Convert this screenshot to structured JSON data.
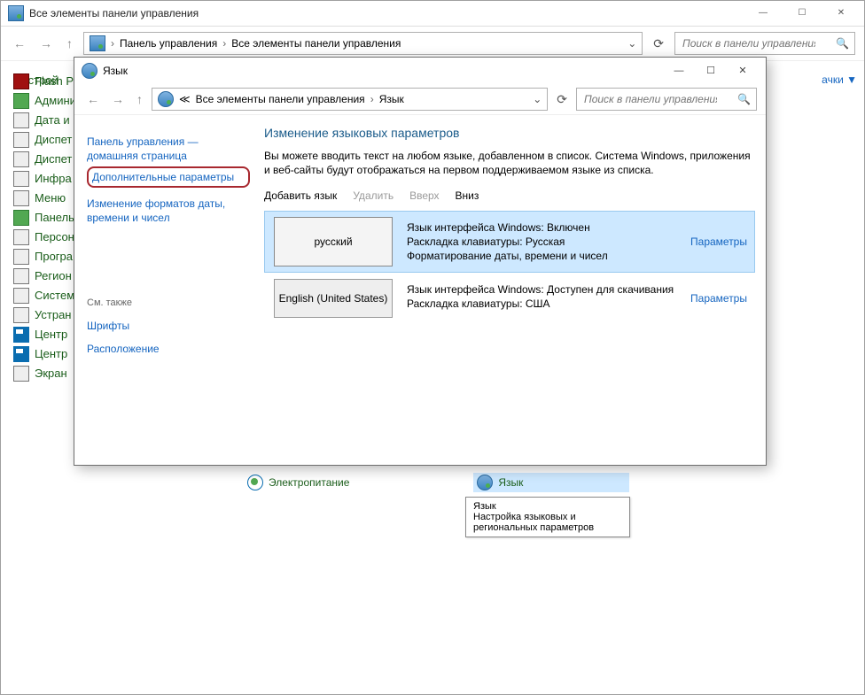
{
  "outer": {
    "title": "Все элементы панели управления",
    "crumb1": "Панель управления",
    "crumb2": "Все элементы панели управления",
    "search_ph": "Поиск в панели управления",
    "heading": "Настрой",
    "partial_link": "ачки ▼",
    "items": [
      "Flash Pl",
      "Админи",
      "Дата и",
      "Диспет",
      "Диспет",
      "Инфра",
      "Меню",
      "Панель",
      "Персон",
      "Програ",
      "Регион",
      "Систем",
      "Устран",
      "Центр",
      "Центр",
      "Экран"
    ],
    "extra_tile1": "Электропитание",
    "extra_tile2": "Язык",
    "tooltip_title": "Язык",
    "tooltip_body": "Настройка языковых и региональных параметров"
  },
  "modal": {
    "title": "Язык",
    "crumb_pre": "≪",
    "crumb1": "Все элементы панели управления",
    "crumb2": "Язык",
    "search_ph": "Поиск в панели управления",
    "side_home1": "Панель управления —",
    "side_home2": "домашняя страница",
    "side_adv": "Дополнительные параметры",
    "side_fmt": "Изменение форматов даты, времени и чисел",
    "side_see": "См. также",
    "side_fonts": "Шрифты",
    "side_loc": "Расположение",
    "heading": "Изменение языковых параметров",
    "para": "Вы можете вводить текст на любом языке, добавленном в список. Система Windows, приложения и веб-сайты будут отображаться на первом поддерживаемом языке из списка.",
    "cmds": {
      "add": "Добавить язык",
      "del": "Удалить",
      "up": "Вверх",
      "down": "Вниз"
    },
    "langs": [
      {
        "name": "русский",
        "lines": [
          "Язык интерфейса Windows: Включен",
          "Раскладка клавиатуры: Русская",
          "Форматирование даты, времени и чисел"
        ],
        "opt": "Параметры"
      },
      {
        "name": "English (United States)",
        "lines": [
          "Язык интерфейса Windows: Доступен для скачивания",
          "Раскладка клавиатуры: США"
        ],
        "opt": "Параметры"
      }
    ]
  }
}
